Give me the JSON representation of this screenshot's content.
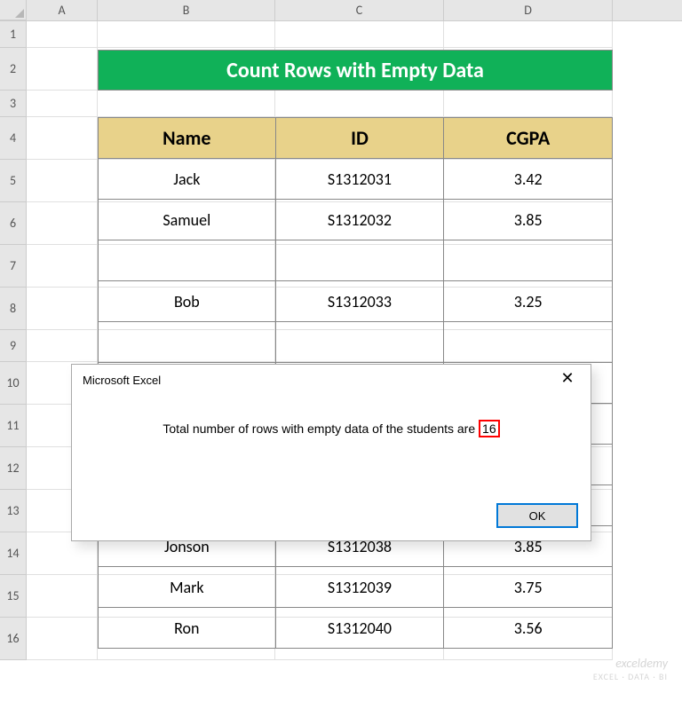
{
  "columns": [
    "A",
    "B",
    "C",
    "D"
  ],
  "rows": [
    "1",
    "2",
    "3",
    "4",
    "5",
    "6",
    "7",
    "8",
    "9",
    "10",
    "11",
    "12",
    "13",
    "14",
    "15",
    "16"
  ],
  "title": "Count Rows with Empty Data",
  "table": {
    "headers": [
      "Name",
      "ID",
      "CGPA"
    ],
    "data": [
      [
        "Jack",
        "S1312031",
        "3.42"
      ],
      [
        "Samuel",
        "S1312032",
        "3.85"
      ],
      [
        "",
        "",
        ""
      ],
      [
        "Bob",
        "S1312033",
        "3.25"
      ],
      [
        "",
        "",
        ""
      ],
      [
        "",
        "",
        ""
      ],
      [
        "",
        "",
        ""
      ],
      [
        "",
        "",
        ""
      ],
      [
        "",
        "",
        ""
      ],
      [
        "Jonson",
        "S1312038",
        "3.85"
      ],
      [
        "Mark",
        "S1312039",
        "3.75"
      ],
      [
        "Ron",
        "S1312040",
        "3.56"
      ]
    ]
  },
  "dialog": {
    "title": "Microsoft Excel",
    "message_prefix": "Total number of rows with empty data of the students are ",
    "highlighted_value": "16",
    "ok_label": "OK"
  },
  "watermark": {
    "main": "exceldemy",
    "sub": "EXCEL · DATA · BI"
  }
}
